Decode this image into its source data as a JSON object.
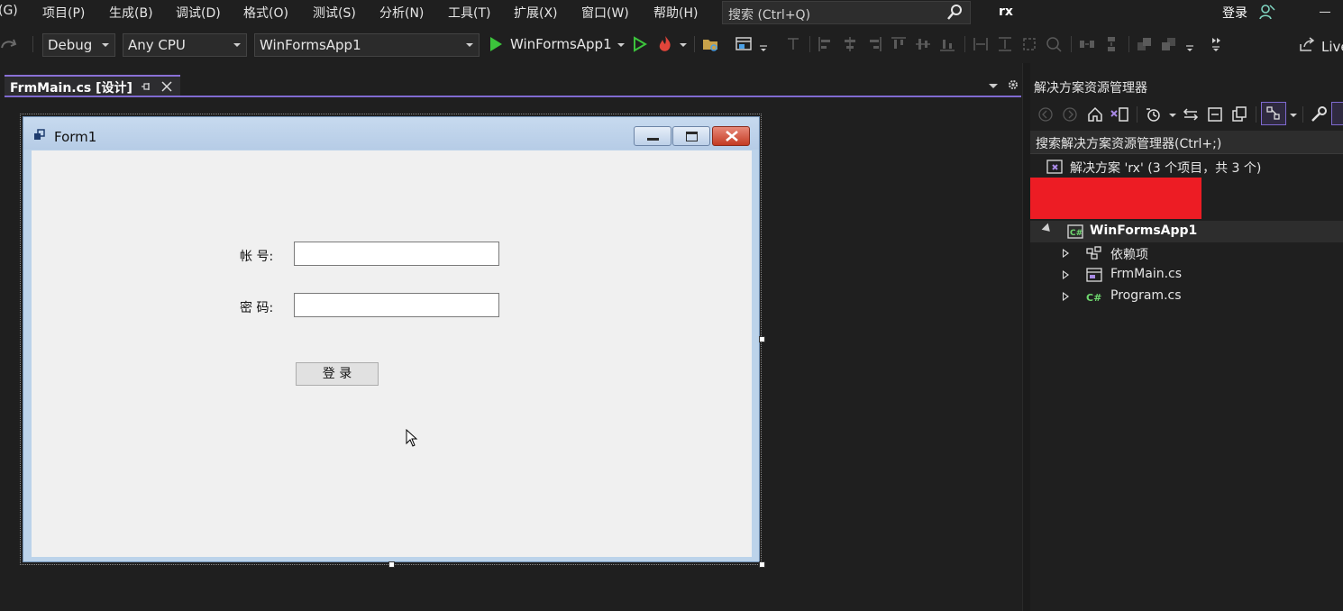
{
  "menu": {
    "items": [
      "(G)",
      "项目(P)",
      "生成(B)",
      "调试(D)",
      "格式(O)",
      "测试(S)",
      "分析(N)",
      "工具(T)",
      "扩展(X)",
      "窗口(W)",
      "帮助(H)"
    ],
    "search_placeholder": "搜索 (Ctrl+Q)",
    "solution_name": "rx",
    "signin_label": "登录"
  },
  "toolbar": {
    "config": "Debug",
    "platform": "Any CPU",
    "startup_project": "WinFormsApp1",
    "run_target": "WinFormsApp1",
    "live_share": "Live"
  },
  "document_tab": {
    "title": "FrmMain.cs [设计]"
  },
  "form": {
    "title": "Form1",
    "account_label": "帐 号:",
    "password_label": "密 码:",
    "account_value": "",
    "password_value": "",
    "login_button": "登 录"
  },
  "solution_explorer": {
    "title": "解决方案资源管理器",
    "search": "搜索解决方案资源管理器(Ctrl+;)",
    "solution_node": "解决方案 'rx' (3 个项目，共 3 个)",
    "project_node": "WinFormsApp1",
    "items": [
      {
        "label": "依赖项",
        "icon": "dependencies-icon"
      },
      {
        "label": "FrmMain.cs",
        "icon": "form-file-icon"
      },
      {
        "label": "Program.cs",
        "icon": "csharp-file-icon"
      }
    ]
  },
  "colors": {
    "accent": "#7f6ad0",
    "run_green": "#3cc43c",
    "redaction": "#ed1c24"
  }
}
